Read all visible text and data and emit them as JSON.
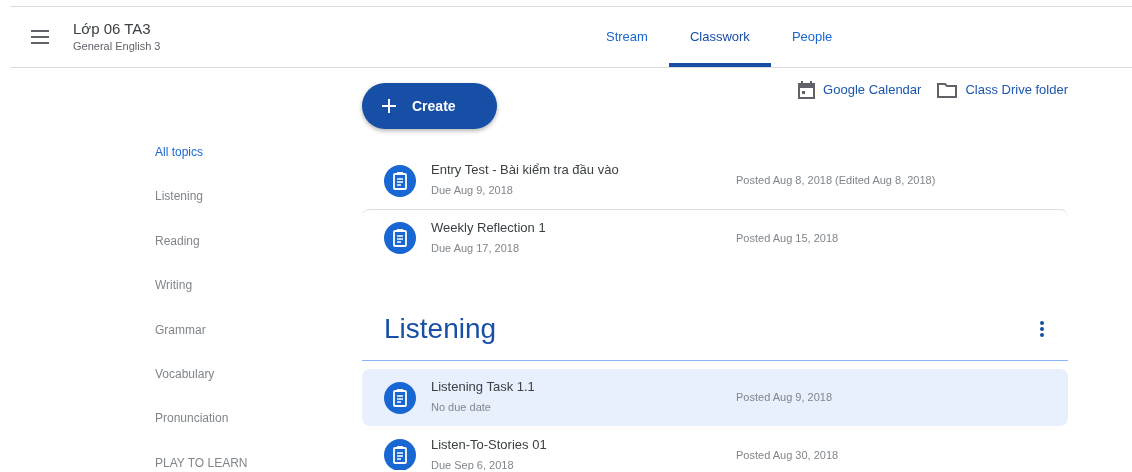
{
  "header": {
    "title": "Lớp 06 TA3",
    "subtitle": "General English 3"
  },
  "tabs": [
    {
      "label": "Stream",
      "selected": false
    },
    {
      "label": "Classwork",
      "selected": true
    },
    {
      "label": "People",
      "selected": false
    }
  ],
  "create_button": "Create",
  "links": [
    {
      "kind": "calendar",
      "label": "Google Calendar"
    },
    {
      "kind": "folder",
      "label": "Class Drive folder"
    }
  ],
  "topics": [
    {
      "label": "All topics",
      "selected": true
    },
    {
      "label": "Listening",
      "selected": false
    },
    {
      "label": "Reading",
      "selected": false
    },
    {
      "label": "Writing",
      "selected": false
    },
    {
      "label": "Grammar",
      "selected": false
    },
    {
      "label": "Vocabulary",
      "selected": false
    },
    {
      "label": "Pronunciation",
      "selected": false
    },
    {
      "label": "PLAY TO LEARN",
      "selected": false
    }
  ],
  "sections": [
    {
      "items": [
        {
          "title": "Entry Test - Bài kiểm tra đầu vào",
          "due": "Due Aug 9, 2018",
          "posted": "Posted Aug 8, 2018 (Edited Aug 8, 2018)",
          "highlighted": false
        },
        {
          "title": "Weekly Reflection 1",
          "due": "Due Aug 17, 2018",
          "posted": "Posted Aug 15, 2018",
          "highlighted": false
        }
      ]
    },
    {
      "title": "Listening",
      "items": [
        {
          "title": "Listening Task 1.1",
          "due": "No due date",
          "posted": "Posted Aug 9, 2018",
          "highlighted": true
        },
        {
          "title": "Listen-To-Stories 01",
          "due": "Due Sep 6, 2018",
          "posted": "Posted Aug 30, 2018",
          "highlighted": false
        }
      ]
    }
  ]
}
